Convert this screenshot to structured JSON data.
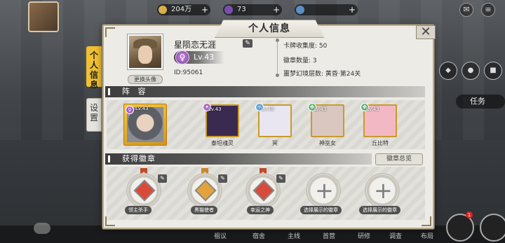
{
  "topbar": {
    "resource_1": "204万",
    "resource_2": "73",
    "plus": "+"
  },
  "right": {
    "task_label": "任务",
    "notification_count": "1"
  },
  "bottom": {
    "items": [
      "祖议",
      "宿舍",
      "主线",
      "首营",
      "研修",
      "调查",
      "布局"
    ]
  },
  "dialog": {
    "title": "个人信息",
    "close": "✕",
    "tabs": {
      "info": "个人信息",
      "settings": "设置"
    },
    "profile": {
      "name": "星陨恋无涯",
      "level": "Lv.43",
      "id": "ID:95061",
      "change_avatar": "更换头像",
      "stats": [
        {
          "label": "卡牌收集度:",
          "value": "50"
        },
        {
          "label": "徽章数量:",
          "value": "3"
        },
        {
          "label": "噩梦幻境层数:",
          "value": "黄昏·第24关"
        }
      ]
    },
    "lineup": {
      "header": "阵 容",
      "leader_level": "Lv.43",
      "cards": [
        {
          "name": "泰坦魂灵",
          "level": "Lv.43",
          "color": "#b06cc9",
          "bg": "#3b2a4f"
        },
        {
          "name": "冥",
          "level": "Lv.43",
          "color": "#6aa7d8",
          "bg": "#e9e6f1"
        },
        {
          "name": "神巫女",
          "level": "Lv.43",
          "color": "#69b57a",
          "bg": "#d9c7c0"
        },
        {
          "name": "丘比特",
          "level": "Lv.43",
          "color": "#69b57a",
          "bg": "#f2b9c4"
        }
      ]
    },
    "badges": {
      "header": "获得徽章",
      "overview": "徽章总览",
      "slots": [
        {
          "label": "领主杀手",
          "filled": true,
          "gem": "#d94a3a"
        },
        {
          "label": "黑猫使者",
          "filled": true,
          "gem": "#e3a33a"
        },
        {
          "label": "幸运之神",
          "filled": true,
          "gem": "#d94a3a"
        },
        {
          "label": "选择展示的徽章",
          "filled": false
        },
        {
          "label": "选择展示的徽章",
          "filled": false
        }
      ]
    }
  }
}
